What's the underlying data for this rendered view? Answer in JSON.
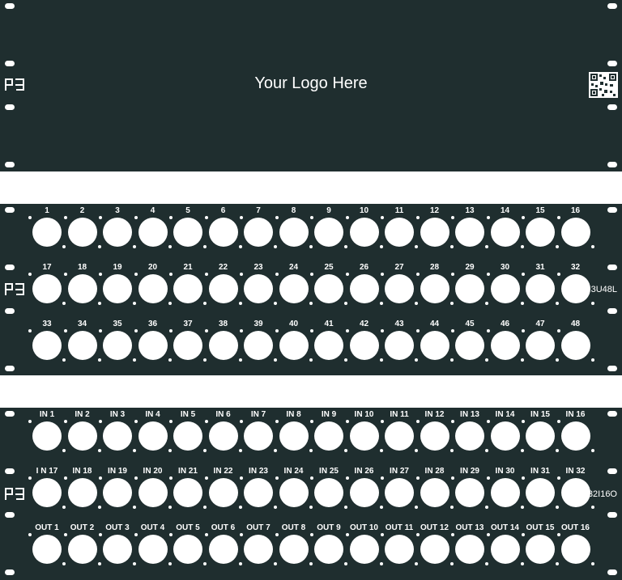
{
  "logo_panel": {
    "logo_text": "Your Logo Here",
    "brand_icon": "pg-brand-logo-icon",
    "qr_icon": "qr-code-icon"
  },
  "panel_3u48l": {
    "model": "3U48L",
    "rows": [
      [
        "1",
        "2",
        "3",
        "4",
        "5",
        "6",
        "7",
        "8",
        "9",
        "10",
        "11",
        "12",
        "13",
        "14",
        "15",
        "16"
      ],
      [
        "17",
        "18",
        "19",
        "20",
        "21",
        "22",
        "23",
        "24",
        "25",
        "26",
        "27",
        "28",
        "29",
        "30",
        "31",
        "32"
      ],
      [
        "33",
        "34",
        "35",
        "36",
        "37",
        "38",
        "39",
        "40",
        "41",
        "42",
        "43",
        "44",
        "45",
        "46",
        "47",
        "48"
      ]
    ]
  },
  "panel_32i16o": {
    "model": "32I16O",
    "rows": [
      [
        "IN 1",
        "IN 2",
        "IN 3",
        "IN 4",
        "IN 5",
        "IN 6",
        "IN 7",
        "IN 8",
        "IN 9",
        "IN 10",
        "IN 11",
        "IN 12",
        "IN 13",
        "IN 14",
        "IN 15",
        "IN 16"
      ],
      [
        "I N 17",
        "IN 18",
        "IN 19",
        "IN 20",
        "IN 21",
        "IN 22",
        "IN 23",
        "IN 24",
        "IN 25",
        "IN 26",
        "IN 27",
        "IN 28",
        "IN 29",
        "IN 30",
        "IN 31",
        "IN 32"
      ],
      [
        "OUT 1",
        "OUT 2",
        "OUT 3",
        "OUT 4",
        "OUT 5",
        "OUT 6",
        "OUT 7",
        "OUT 8",
        "OUT 9",
        "OUT 10",
        "OUT 11",
        "OUT 12",
        "OUT 13",
        "OUT 14",
        "OUT 15",
        "OUT 16"
      ]
    ]
  },
  "colors": {
    "panel": "#1f2e2f",
    "foreground": "#ffffff"
  }
}
